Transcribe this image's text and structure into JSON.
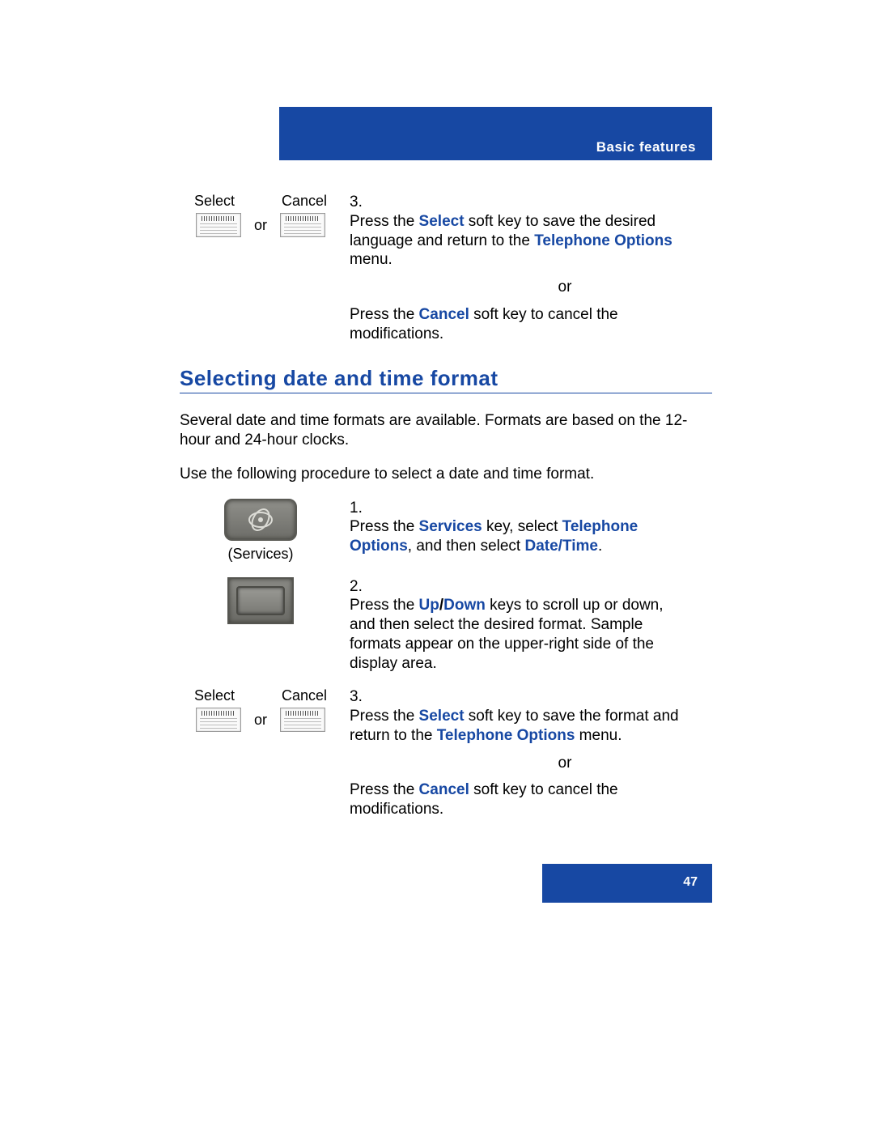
{
  "header": {
    "section": "Basic features"
  },
  "footer": {
    "page_number": "47"
  },
  "top_step": {
    "softkey_left": "Select",
    "softkey_right": "Cancel",
    "softkey_or": "or",
    "number": "3.",
    "press_the_1": "Press the ",
    "select_key": "Select",
    "after_select": " soft key to save the desired language and return to the ",
    "telephone_options": "Telephone Options",
    "menu_suffix": " menu.",
    "or_center": "or",
    "press_the_2": "Press the ",
    "cancel_key": "Cancel",
    "after_cancel": " soft key to cancel the modifications."
  },
  "section": {
    "heading": "Selecting date and time format",
    "para1": "Several date and time formats are available. Formats are based on the 12-hour and 24-hour clocks.",
    "para2": "Use the following procedure to select a date and time format.",
    "step1": {
      "number": "1.",
      "caption": "(Services)",
      "press_the": "Press the ",
      "services_key": "Services",
      "mid": " key, select ",
      "telephone_options": "Telephone Options",
      "and_then": ", and then select ",
      "date_time": "Date/Time",
      "period": "."
    },
    "step2": {
      "number": "2.",
      "press_the": "Press the ",
      "up": "Up",
      "slash": "/",
      "down": "Down",
      "rest": " keys to scroll up or down, and then select the desired format. Sample formats appear on the upper-right side of the display area."
    },
    "step3": {
      "softkey_left": "Select",
      "softkey_right": "Cancel",
      "softkey_or": "or",
      "number": "3.",
      "press_the_1": "Press the ",
      "select_key": "Select",
      "after_select": " soft key to save the format and return to the ",
      "telephone_options": "Telephone Options",
      "menu_suffix": " menu.",
      "or_center": "or",
      "press_the_2": "Press the ",
      "cancel_key": "Cancel",
      "after_cancel": " soft key to cancel the modifications."
    }
  }
}
